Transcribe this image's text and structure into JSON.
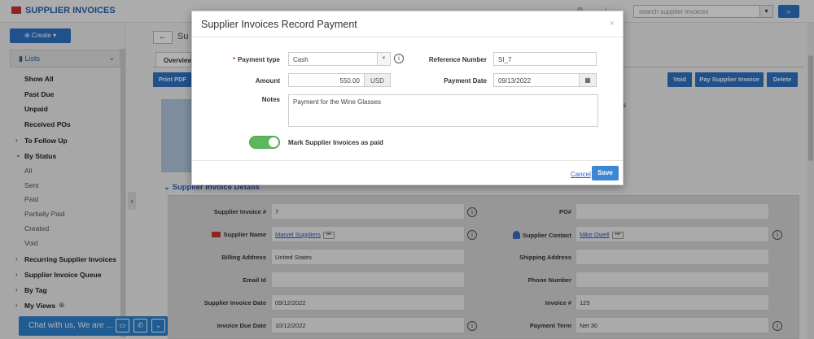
{
  "app": {
    "title": "SUPPLIER INVOICES",
    "search_placeholder": "search supplier invoices"
  },
  "sidebar": {
    "create_label": "Create",
    "lists_label": "Lists",
    "items": [
      {
        "label": "Show All",
        "type": "bold"
      },
      {
        "label": "Past Due",
        "type": "bold"
      },
      {
        "label": "Unpaid",
        "type": "bold"
      },
      {
        "label": "Received POs",
        "type": "bold"
      },
      {
        "label": "To Follow Up",
        "type": "group"
      },
      {
        "label": "By Status",
        "type": "group-open"
      },
      {
        "label": "All",
        "type": "sub"
      },
      {
        "label": "Sent",
        "type": "sub"
      },
      {
        "label": "Paid",
        "type": "sub"
      },
      {
        "label": "Partially Paid",
        "type": "sub"
      },
      {
        "label": "Created",
        "type": "sub"
      },
      {
        "label": "Void",
        "type": "sub"
      },
      {
        "label": "Recurring Supplier Invoices",
        "type": "group"
      },
      {
        "label": "Supplier Invoice Queue",
        "type": "group"
      },
      {
        "label": "By Tag",
        "type": "group"
      },
      {
        "label": "My Views",
        "type": "group"
      }
    ]
  },
  "main": {
    "page_title": "Su",
    "tab_overview": "Overview",
    "print_pdf": "Print PDF",
    "void": "Void",
    "pay": "Pay Supplier Invoice",
    "delete": "Delete",
    "side_suffix": "s",
    "section_title": "Supplier Invoice Details",
    "fields_left": [
      {
        "label": "Supplier Invoice #",
        "value": "7"
      },
      {
        "label": "Supplier Name",
        "value": "Marvel Suppliers"
      },
      {
        "label": "Billing Address",
        "value": "United States"
      },
      {
        "label": "Email Id",
        "value": ""
      },
      {
        "label": "Supplier Invoice Date",
        "value": "09/12/2022"
      },
      {
        "label": "Invoice Due Date",
        "value": "10/12/2022"
      }
    ],
    "fields_right": [
      {
        "label": "PO#",
        "value": ""
      },
      {
        "label": "Supplier Contact",
        "value": "Mike Owell"
      },
      {
        "label": "Shipping Address",
        "value": ""
      },
      {
        "label": "Phone Number",
        "value": ""
      },
      {
        "label": "Invoice #",
        "value": "125"
      },
      {
        "label": "Payment Term",
        "value": "Net 30"
      }
    ]
  },
  "chat": {
    "label": "Chat with us, We are ..."
  },
  "modal": {
    "title": "Supplier Invoices Record Payment",
    "close": "×",
    "payment_type_label": "Payment type",
    "payment_type_value": "Cash",
    "reference_label": "Reference Number",
    "reference_value": "SI_7",
    "amount_label": "Amount",
    "amount_value": "550.00",
    "currency": "USD",
    "payment_date_label": "Payment Date",
    "payment_date_value": "09/13/2022",
    "notes_label": "Notes",
    "notes_value": "Payment for the Wine Glasses",
    "toggle_label": "Mark Supplier Invoices as paid",
    "toggle_on": true,
    "cancel": "Cancel",
    "save": "Save"
  },
  "colors": {
    "accent": "#2f74c9",
    "toggle_on": "#5cb85c",
    "brand_text": "#2a61b6"
  }
}
